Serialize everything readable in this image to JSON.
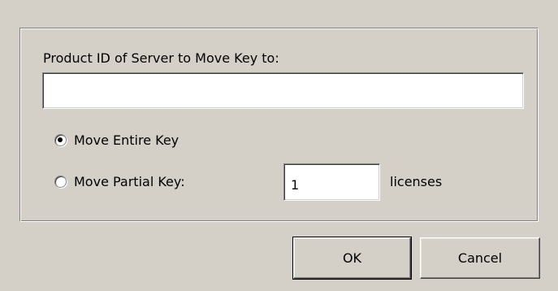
{
  "dialog": {
    "product_id_label": "Product ID of Server to Move Key to:",
    "product_id_value": "",
    "options": {
      "move_entire_key_label": "Move Entire Key",
      "move_entire_key_selected": true,
      "move_partial_key_label": "Move Partial Key:",
      "move_partial_key_selected": false,
      "partial_licenses_value": "1",
      "licenses_unit_label": "licenses"
    },
    "buttons": {
      "ok_label": "OK",
      "cancel_label": "Cancel"
    }
  },
  "colors": {
    "dialog_background": "#d4d0c8",
    "input_background": "#ffffff"
  }
}
